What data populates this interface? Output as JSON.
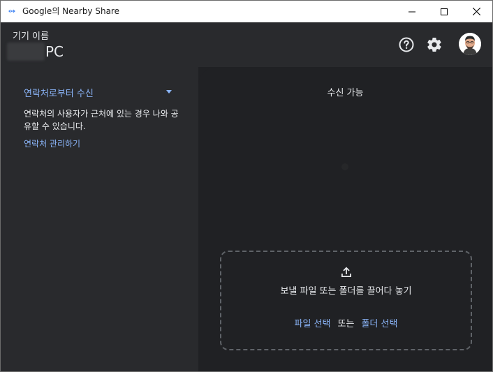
{
  "window": {
    "title": "Google의 Nearby Share"
  },
  "header": {
    "device_label": "기기 이름",
    "device_name_suffix": "PC"
  },
  "left": {
    "visibility_label": "연락처로부터 수신",
    "visibility_description": "연락처의 사용자가 근처에 있는 경우 나와 공유할 수 있습니다.",
    "manage_contacts": "연락처 관리하기"
  },
  "right": {
    "status": "수신 가능",
    "drop_text": "보낼 파일 또는 폴더를 끌어다 놓기",
    "select_file": "파일 선택",
    "or": "또는",
    "select_folder": "폴더 선택"
  },
  "colors": {
    "accent": "#8ab4f8",
    "panel": "#292a2d",
    "background": "#202124"
  },
  "icons": [
    "nearby-share-icon",
    "minimize-icon",
    "maximize-icon",
    "close-icon",
    "help-icon",
    "gear-icon",
    "avatar",
    "upload-icon",
    "dropdown-arrow-icon"
  ]
}
